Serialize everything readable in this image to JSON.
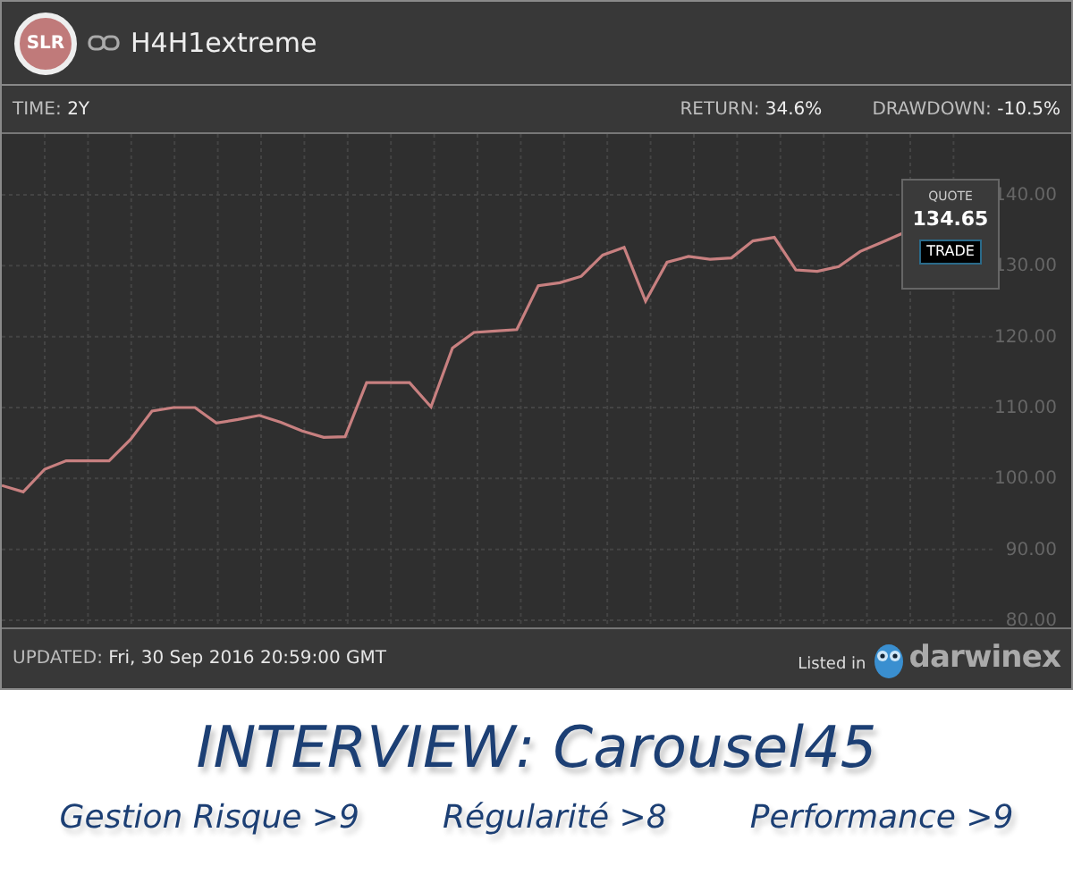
{
  "header": {
    "avatar_text": "SLR",
    "title": "H4H1extreme"
  },
  "stats": {
    "time": {
      "label": "TIME:",
      "value": "2Y"
    },
    "return": {
      "label": "RETURN:",
      "value": "34.6%"
    },
    "drawdown": {
      "label": "DRAWDOWN:",
      "value": "-10.5%"
    }
  },
  "chart": {
    "quote": {
      "label": "QUOTE",
      "value": "134.65",
      "button": "TRADE"
    },
    "chart_data": {
      "type": "line",
      "grid": true,
      "ylim": [
        80,
        140
      ],
      "yticks": [
        {
          "value": 140,
          "label": "140.00"
        },
        {
          "value": 130,
          "label": "130.00"
        },
        {
          "value": 120,
          "label": "120.00"
        },
        {
          "value": 110,
          "label": "110.00"
        },
        {
          "value": 100,
          "label": "100.00"
        },
        {
          "value": 90,
          "label": "90.00"
        },
        {
          "value": 80,
          "label": "80.00"
        }
      ],
      "categories": [
        null,
        null,
        null,
        null,
        null,
        null,
        null,
        null,
        null,
        null,
        null,
        null,
        null,
        null,
        null,
        null,
        null,
        null,
        null,
        null,
        null,
        null,
        null,
        null,
        null,
        null,
        null,
        null,
        null,
        null,
        null,
        null,
        null,
        null,
        null,
        null,
        null,
        null,
        null,
        null,
        null,
        null,
        null
      ],
      "series": [
        {
          "color": "#c88080",
          "values": [
            99,
            98.1,
            101.3,
            102.5,
            102.5,
            102.5,
            105.5,
            109.5,
            110,
            110,
            107.8,
            108.3,
            108.9,
            107.9,
            106.7,
            105.8,
            105.9,
            113.5,
            113.5,
            113.5,
            110.1,
            118.4,
            120.6,
            120.8,
            121,
            127.2,
            127.6,
            128.5,
            131.5,
            132.6,
            125,
            130.5,
            131.3,
            130.9,
            131.1,
            133.5,
            134,
            129.4,
            129.2,
            129.9,
            132,
            133.3,
            134.6
          ]
        }
      ]
    }
  },
  "footer": {
    "updated_label": "UPDATED:",
    "updated_value": "Fri, 30 Sep 2016 20:59:00 GMT",
    "listed": "Listed in",
    "brand": "darwinex"
  },
  "banner": {
    "title": "INTERVIEW: Carousel45",
    "scores": [
      "Gestion Risque >9",
      "Régularité >8",
      "Performance >9"
    ]
  }
}
